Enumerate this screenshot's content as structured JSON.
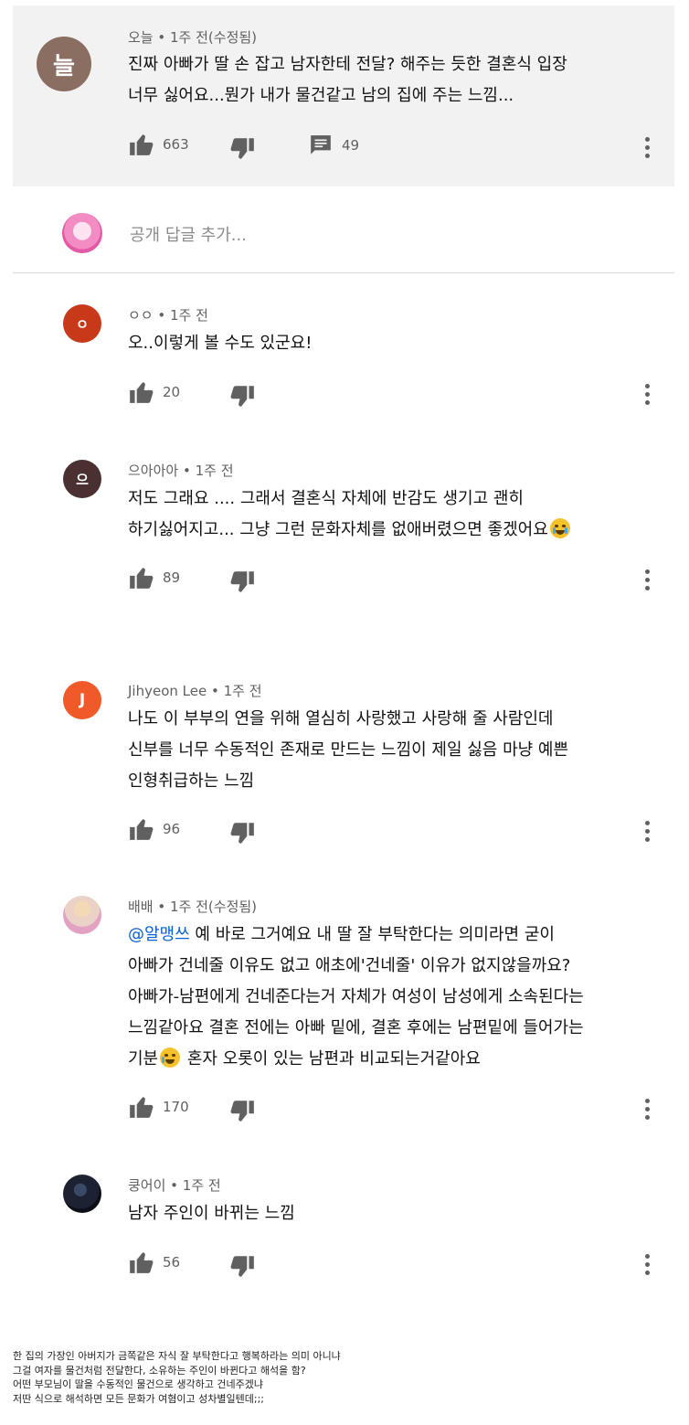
{
  "top_comment": {
    "avatar_letter": "늘",
    "author": "오늘",
    "time": "1주 전(수정됨)",
    "lines": [
      "진짜 아빠가 딸 손 잡고 남자한테 전달? 해주는 듯한 결혼식 입장",
      "너무 싫어요...뭔가 내가 물건같고 남의 집에 주는 느낌..."
    ],
    "likes": "663",
    "replies": "49"
  },
  "reply_box": {
    "placeholder": "공개 답글 추가..."
  },
  "replies": [
    {
      "avatar_letter": "ㅇ",
      "author": "ㅇㅇ",
      "time": "1주 전",
      "lines": [
        "오..이렇게 볼 수도 있군요!"
      ],
      "likes": "20"
    },
    {
      "avatar_letter": "으",
      "author": "으아아아",
      "time": "1주 전",
      "lines": [
        "저도 그래요 .... 그래서 결혼식 자체에 반감도 생기고 괜히",
        "하기싫어지고... 그냥 그런 문화자체를 없애버렸으면 좋겠어요"
      ],
      "likes": "89"
    },
    {
      "avatar_letter": "J",
      "author": "Jihyeon Lee",
      "time": "1주 전",
      "lines": [
        "나도 이 부부의 연을 위해 열심히 사랑했고 사랑해 줄 사람인데",
        "신부를 너무 수동적인 존재로 만드는 느낌이 제일 싫음 마냥 예쁜",
        "인형취급하는 느낌"
      ],
      "likes": "96"
    },
    {
      "author": "배배",
      "time": "1주 전(수정됨)",
      "mention": "@알맹쓰",
      "lines": [
        " 예 바로 그거예요 내 딸 잘 부탁한다는 의미라면 굳이",
        "아빠가 건네줄 이유도 없고 애초에'건네줄' 이유가 없지않을까요?",
        "아빠가-남편에게 건네준다는거 자체가 여성이 남성에게 소속된다는",
        "느낌같아요 결혼 전에는 아빠 밑에, 결혼 후에는 남편밑에 들어가는",
        "기분",
        " 혼자 오롯이 있는 남편과 비교되는거같아요"
      ],
      "likes": "170"
    },
    {
      "author": "쿵어이",
      "time": "1주 전",
      "lines": [
        "남자 주인이 바뀌는 느낌"
      ],
      "likes": "56"
    }
  ],
  "footer_note": [
    "한 집의 가장인 아버지가 금쪽같은 자식 잘 부탁한다고 행복하라는 의미 아니냐",
    "그걸 여자를 물건처럼 전달한다, 소유하는 주인이 바뀐다고 해석을 함?",
    "어떤 부모님이 딸을 수동적인 물건으로 생각하고 건네주겠냐",
    "저딴 식으로 해석하면 모든 문화가 여혐이고 성차별일텐데;;;"
  ],
  "colors": {
    "avatar_top": "#8a6e62",
    "avatar_oo": "#c8391a",
    "avatar_eu": "#4a3030",
    "avatar_j": "#f05a28",
    "mention": "#065fd4"
  }
}
